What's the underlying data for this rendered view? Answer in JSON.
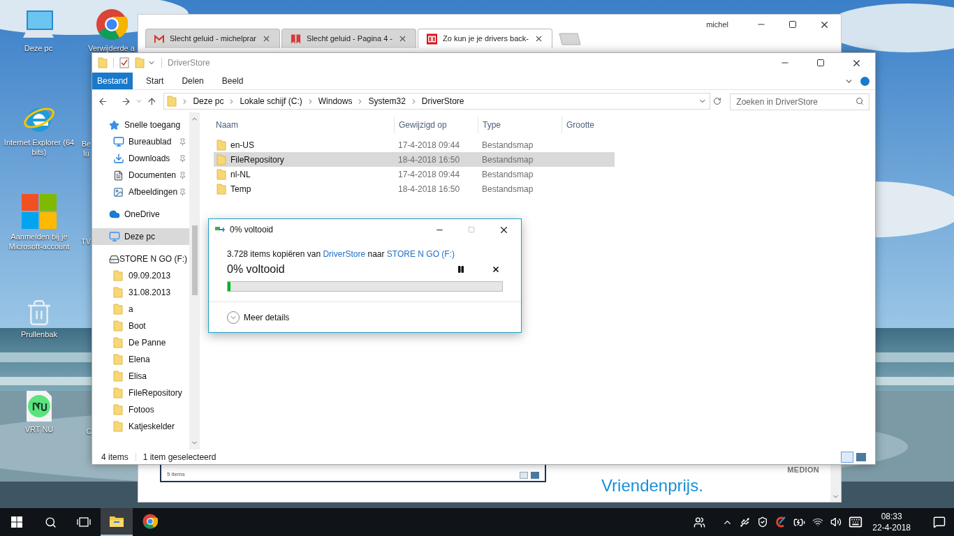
{
  "desktop_icons": [
    {
      "label": "Deze pc",
      "kind": "computer"
    },
    {
      "label": "Verwijderde a",
      "kind": "chrome"
    },
    {
      "label": "Internet Explorer (64 bits)",
      "kind": "ie"
    },
    {
      "label": "Be lu",
      "kind": "partial"
    },
    {
      "label": "Aanmelden bij je Microsoft-account",
      "kind": "microsoft"
    },
    {
      "label": "TV",
      "kind": "partial"
    },
    {
      "label": "Prullenbak",
      "kind": "recycle"
    },
    {
      "label": "VRT NU",
      "kind": "vrtnu"
    },
    {
      "label": "C",
      "kind": "partial"
    }
  ],
  "browser": {
    "user": "michel",
    "tabs": [
      {
        "title": "Slecht geluid - michelprar",
        "kind": "mail",
        "selected": false
      },
      {
        "title": "Slecht geluid - Pagina 4 -",
        "kind": "forum",
        "selected": false
      },
      {
        "title": "Zo kun je je drivers back-",
        "kind": "co",
        "selected": true
      }
    ],
    "page": {
      "embedded_status": "5 items",
      "ad_brand": "MEDION",
      "ad_headline": "Vriendenprijs."
    }
  },
  "explorer": {
    "title": "DriverStore",
    "ribbon_tabs": [
      {
        "label": "Bestand",
        "selected": true
      },
      {
        "label": "Start",
        "selected": false
      },
      {
        "label": "Delen",
        "selected": false
      },
      {
        "label": "Beeld",
        "selected": false
      }
    ],
    "breadcrumbs": [
      "Deze pc",
      "Lokale schijf (C:)",
      "Windows",
      "System32",
      "DriverStore"
    ],
    "search": {
      "placeholder": "Zoeken in DriverStore"
    },
    "nav": [
      {
        "label": "Snelle toegang",
        "kind": "star",
        "selected": false,
        "children": [
          {
            "label": "Bureaublad",
            "kind": "desktop",
            "pinned": true,
            "selected": false
          },
          {
            "label": "Downloads",
            "kind": "download",
            "pinned": true,
            "selected": false
          },
          {
            "label": "Documenten",
            "kind": "document",
            "pinned": true,
            "selected": false
          },
          {
            "label": "Afbeeldingen",
            "kind": "pictures",
            "pinned": true,
            "selected": false
          }
        ]
      },
      {
        "label": "OneDrive",
        "kind": "cloud",
        "selected": false
      },
      {
        "label": "Deze pc",
        "kind": "pc",
        "selected": true
      },
      {
        "label": "STORE N GO (F:)",
        "kind": "drive",
        "selected": false,
        "children": [
          {
            "label": "09.09.2013",
            "kind": "folder",
            "selected": false
          },
          {
            "label": "31.08.2013",
            "kind": "folder",
            "selected": false
          },
          {
            "label": "a",
            "kind": "folder",
            "selected": false
          },
          {
            "label": "Boot",
            "kind": "folder",
            "selected": false
          },
          {
            "label": "De Panne",
            "kind": "folder",
            "selected": false
          },
          {
            "label": "Elena",
            "kind": "folder",
            "selected": false
          },
          {
            "label": "Elisa",
            "kind": "folder",
            "selected": false
          },
          {
            "label": "FileRepository",
            "kind": "folder",
            "selected": false
          },
          {
            "label": "Fotoos",
            "kind": "folder",
            "selected": false
          },
          {
            "label": "Katjeskelder",
            "kind": "folder",
            "selected": false
          }
        ]
      }
    ],
    "columns": [
      "Naam",
      "Gewijzigd op",
      "Type",
      "Grootte"
    ],
    "rows": [
      {
        "name": "en-US",
        "modified": "17-4-2018 09:44",
        "type": "Bestandsmap",
        "selected": false
      },
      {
        "name": "FileRepository",
        "modified": "18-4-2018 16:50",
        "type": "Bestandsmap",
        "selected": true
      },
      {
        "name": "nl-NL",
        "modified": "17-4-2018 09:44",
        "type": "Bestandsmap",
        "selected": false
      },
      {
        "name": "Temp",
        "modified": "18-4-2018 16:50",
        "type": "Bestandsmap",
        "selected": false
      }
    ],
    "status": {
      "count": "4 items",
      "selection": "1 item geselecteerd"
    }
  },
  "copy_dialog": {
    "title": "0% voltooid",
    "message": {
      "before": "3.728 items kopiëren van",
      "source": "DriverStore",
      "middle": "naar",
      "target": "STORE N GO (F:)"
    },
    "progress_label": "0% voltooid",
    "level": 0.01,
    "details": "Meer details"
  },
  "taskbar": {
    "apps": [
      {
        "kind": "explorer",
        "selected": true
      },
      {
        "kind": "chrome",
        "selected": false
      }
    ],
    "time": "08:33",
    "date": "22-4-2018"
  }
}
